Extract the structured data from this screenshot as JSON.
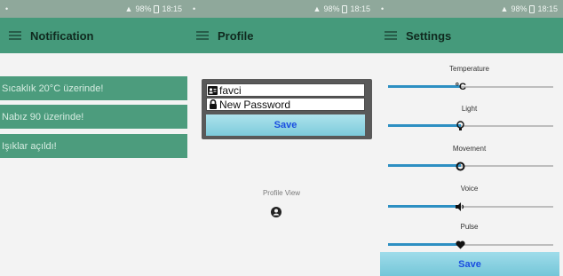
{
  "status_bar": {
    "signal": "▲",
    "battery_pct": "98%",
    "time": "18:15"
  },
  "notification": {
    "title": "Notification",
    "items": [
      "Sıcaklık 20°C üzerinde!",
      "Nabız 90 üzerinde!",
      "Işıklar açıldı!"
    ]
  },
  "profile": {
    "title": "Profile",
    "username_value": "favci",
    "password_placeholder": "New Password",
    "save_label": "Save",
    "view_label": "Profile View"
  },
  "settings": {
    "title": "Settings",
    "sliders": [
      {
        "label": "Temperature",
        "level": 0.44,
        "thumb": "°C"
      },
      {
        "label": "Light",
        "level": 0.44,
        "thumb": "lightbulb-icon"
      },
      {
        "label": "Movement",
        "level": 0.44,
        "thumb": "circle-icon"
      },
      {
        "label": "Voice",
        "level": 0.44,
        "thumb": "speaker-icon"
      },
      {
        "label": "Pulse",
        "level": 0.44,
        "thumb": "heart-icon"
      }
    ],
    "save_label": "Save"
  },
  "colors": {
    "appbar": "#459a7b",
    "notif_item": "#4c9c7d",
    "slider_fill": "#2d8fc2",
    "save_button_text": "#1a4ee0"
  }
}
